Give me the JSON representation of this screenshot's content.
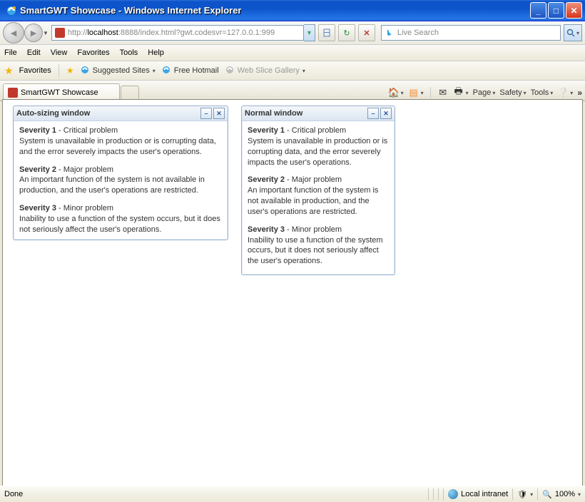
{
  "window": {
    "title": "SmartGWT Showcase - Windows Internet Explorer",
    "minimize_tip": "Minimize",
    "maximize_tip": "Maximize",
    "close_tip": "Close"
  },
  "address": {
    "host": "localhost",
    "rest": ":8888/index.html?gwt.codesvr=127.0.0.1:999",
    "full": "http://localhost:8888/index.html?gwt.codesvr=127.0.0.1:999"
  },
  "search": {
    "placeholder": "Live Search"
  },
  "menubar": {
    "file": "File",
    "edit": "Edit",
    "view": "View",
    "favorites": "Favorites",
    "tools": "Tools",
    "help": "Help"
  },
  "linksbar": {
    "favorites": "Favorites",
    "suggested": "Suggested Sites",
    "hotmail": "Free Hotmail",
    "webslice": "Web Slice Gallery"
  },
  "tab": {
    "label": "SmartGWT Showcase"
  },
  "cmdbar": {
    "page": "Page",
    "safety": "Safety",
    "tools": "Tools"
  },
  "windows": {
    "auto": {
      "title": "Auto-sizing window"
    },
    "normal": {
      "title": "Normal window"
    }
  },
  "severity": [
    {
      "label": "Severity 1",
      "name": "Critical problem",
      "desc": "System is unavailable in production or is corrupting data, and the error severely impacts the user's operations."
    },
    {
      "label": "Severity 2",
      "name": "Major problem",
      "desc": "An important function of the system is not available in production, and the user's operations are restricted."
    },
    {
      "label": "Severity 3",
      "name": "Minor problem",
      "desc": "Inability to use a function of the system occurs, but it does not seriously affect the user's operations."
    }
  ],
  "status": {
    "done": "Done",
    "zone": "Local intranet",
    "zoom": "100%"
  }
}
